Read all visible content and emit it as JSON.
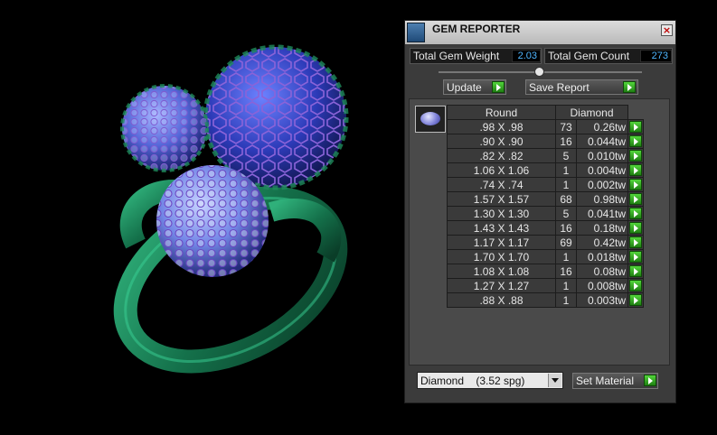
{
  "panel": {
    "title": "GEM REPORTER",
    "close": "×",
    "total_weight_label": "Total Gem Weight",
    "total_weight_value": "2.03",
    "total_count_label": "Total Gem Count",
    "total_count_value": "273"
  },
  "buttons": {
    "update": "Update",
    "save_report": "Save Report",
    "set_material": "Set Material"
  },
  "table": {
    "headers": [
      "Round",
      "Diamond"
    ],
    "rows": [
      {
        "size": ".98 X .98",
        "count": "73",
        "weight": "0.26tw"
      },
      {
        "size": ".90 X .90",
        "count": "16",
        "weight": "0.044tw"
      },
      {
        "size": ".82 X .82",
        "count": "5",
        "weight": "0.010tw"
      },
      {
        "size": "1.06 X 1.06",
        "count": "1",
        "weight": "0.004tw"
      },
      {
        "size": ".74 X .74",
        "count": "1",
        "weight": "0.002tw"
      },
      {
        "size": "1.57 X 1.57",
        "count": "68",
        "weight": "0.98tw"
      },
      {
        "size": "1.30 X 1.30",
        "count": "5",
        "weight": "0.041tw"
      },
      {
        "size": "1.43 X 1.43",
        "count": "16",
        "weight": "0.18tw"
      },
      {
        "size": "1.17 X 1.17",
        "count": "69",
        "weight": "0.42tw"
      },
      {
        "size": "1.70 X 1.70",
        "count": "1",
        "weight": "0.018tw"
      },
      {
        "size": "1.08 X 1.08",
        "count": "16",
        "weight": "0.08tw"
      },
      {
        "size": "1.27 X 1.27",
        "count": "1",
        "weight": "0.008tw"
      },
      {
        "size": ".88 X .88",
        "count": "1",
        "weight": "0.003tw"
      }
    ]
  },
  "material": {
    "selected": "Diamond    (3.52 spg)"
  },
  "colors": {
    "ring_band": "#1f8a5c",
    "gem_blue": "#3a48d8",
    "accent_green": "#3fbf2a",
    "value_text": "#4fb6ff"
  }
}
